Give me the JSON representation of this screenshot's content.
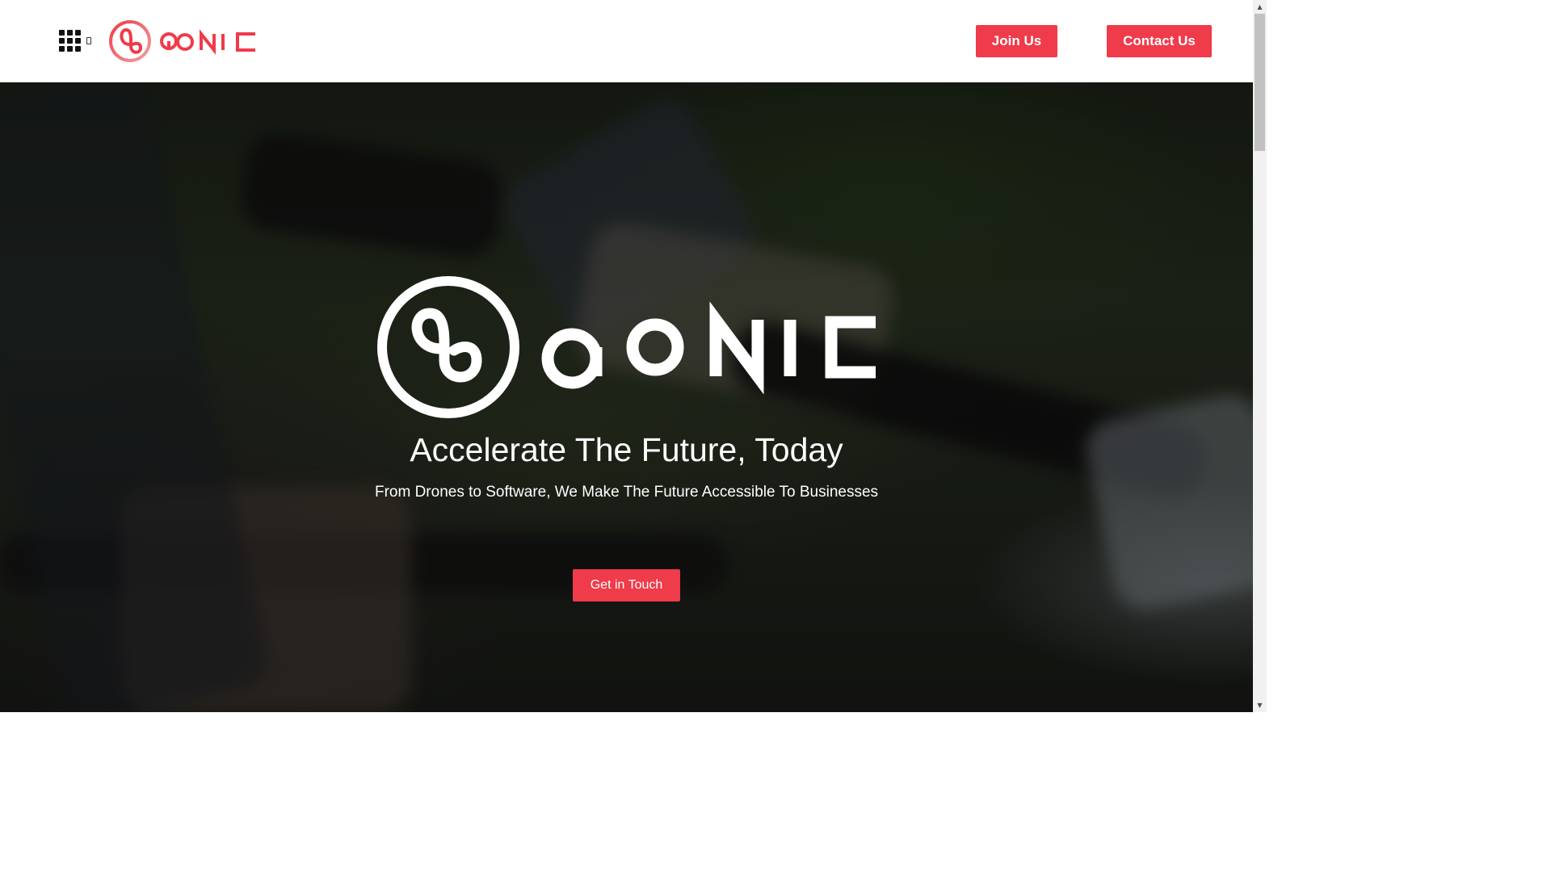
{
  "header": {
    "menu_icon": "grid-menu-icon",
    "logo_text": "aonic",
    "join_label": "Join Us",
    "contact_label": "Contact Us"
  },
  "hero": {
    "logo_text": "aonic",
    "title": "Accelerate The Future, Today",
    "subtitle": "From Drones to Software, We Make The Future Accessible To Businesses",
    "cta_label": "Get in Touch"
  },
  "colors": {
    "accent": "#ef3b4a",
    "header_bg": "#ffffff",
    "hero_text": "#ffffff"
  },
  "scrollbar": {
    "up_icon": "scroll-up-arrow-icon",
    "down_icon": "scroll-down-arrow-icon"
  }
}
